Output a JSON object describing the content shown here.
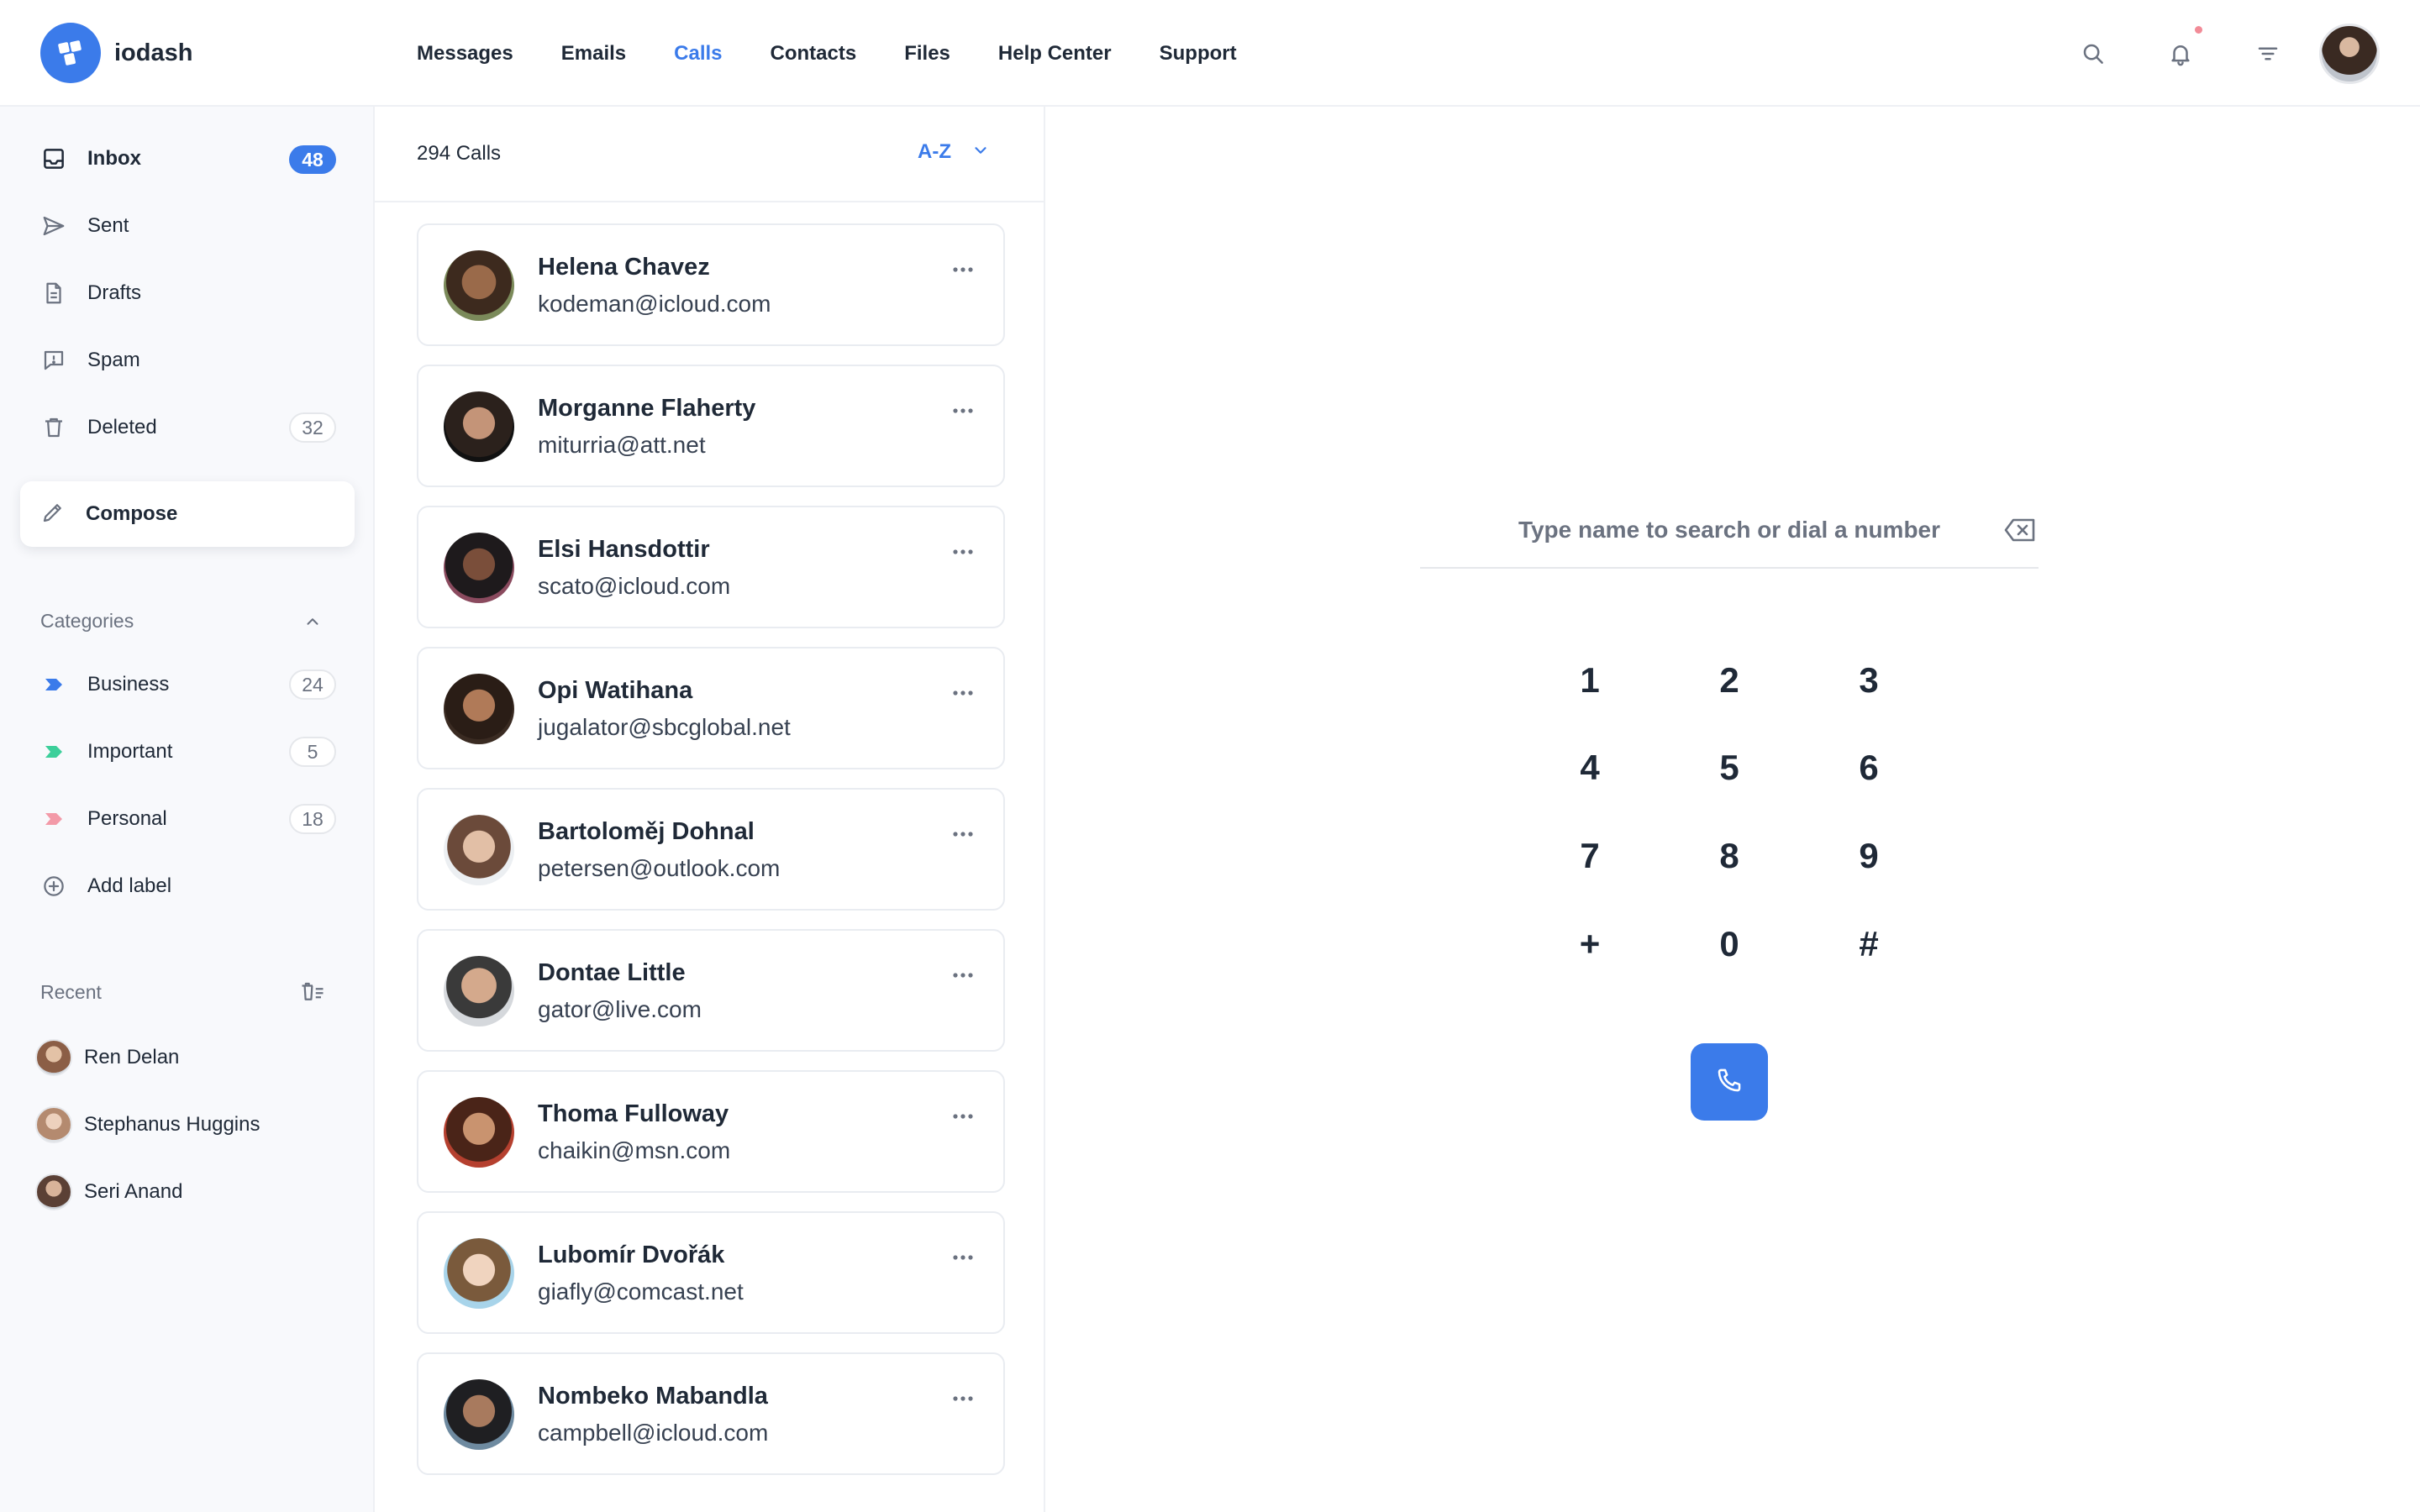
{
  "app": {
    "name": "iodash",
    "accent": "#3b7bea"
  },
  "nav": [
    {
      "label": "Messages",
      "active": false
    },
    {
      "label": "Emails",
      "active": false
    },
    {
      "label": "Calls",
      "active": true
    },
    {
      "label": "Contacts",
      "active": false
    },
    {
      "label": "Files",
      "active": false
    },
    {
      "label": "Help Center",
      "active": false
    },
    {
      "label": "Support",
      "active": false
    }
  ],
  "header_icons": [
    "search-icon",
    "bell-icon",
    "filter-icon",
    "user-avatar"
  ],
  "sidebar": {
    "mailboxes": [
      {
        "label": "Inbox",
        "icon": "inbox-icon",
        "count": "48"
      },
      {
        "label": "Sent",
        "icon": "send-icon"
      },
      {
        "label": "Drafts",
        "icon": "draft-icon"
      },
      {
        "label": "Spam",
        "icon": "spam-icon"
      },
      {
        "label": "Deleted",
        "icon": "trash-icon",
        "count": "32"
      }
    ],
    "compose_label": "Compose",
    "categories_title": "Categories",
    "categories": [
      {
        "label": "Business",
        "count": "24",
        "color": "#3b7bea"
      },
      {
        "label": "Important",
        "count": "5",
        "color": "#3ccf9a"
      },
      {
        "label": "Personal",
        "count": "18",
        "color": "#f39aa8"
      }
    ],
    "add_label": "Add label",
    "recent_title": "Recent",
    "recent": [
      {
        "name": "Ren Delan"
      },
      {
        "name": "Stephanus Huggins"
      },
      {
        "name": "Seri Anand"
      }
    ]
  },
  "calls": {
    "count_label": "294 Calls",
    "sort_label": "A-Z",
    "items": [
      {
        "name": "Helena Chavez",
        "email": "kodeman@icloud.com"
      },
      {
        "name": "Morganne Flaherty",
        "email": "miturria@att.net"
      },
      {
        "name": "Elsi Hansdottir",
        "email": "scato@icloud.com"
      },
      {
        "name": "Opi Watihana",
        "email": "jugalator@sbcglobal.net"
      },
      {
        "name": "Bartoloměj Dohnal",
        "email": "petersen@outlook.com"
      },
      {
        "name": "Dontae Little",
        "email": "gator@live.com"
      },
      {
        "name": "Thoma Fulloway",
        "email": "chaikin@msn.com"
      },
      {
        "name": "Lubomír Dvořák",
        "email": "giafly@comcast.net"
      },
      {
        "name": "Nombeko Mabandla",
        "email": "campbell@icloud.com"
      }
    ]
  },
  "dialer": {
    "placeholder": "Type name to search or dial a number",
    "keys": [
      "1",
      "2",
      "3",
      "4",
      "5",
      "6",
      "7",
      "8",
      "9",
      "+",
      "0",
      "#"
    ]
  }
}
